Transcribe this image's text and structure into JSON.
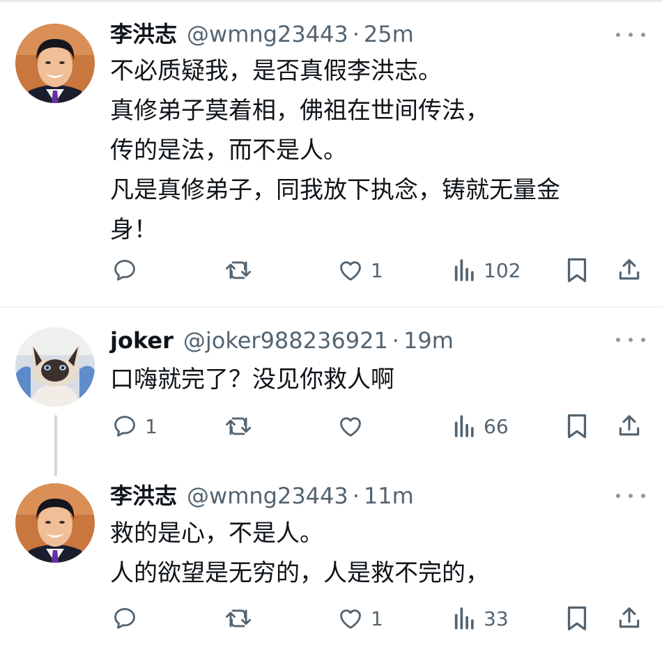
{
  "tweets": [
    {
      "name": "李洪志",
      "handle": "@wmng23443",
      "separator": "·",
      "time": "25m",
      "lines": [
        "不必质疑我，是否真假李洪志。",
        "真修弟子莫着相，佛祖在世间传法，",
        "传的是法，而不是人。",
        "凡是真修弟子，同我放下执念，铸就无量金",
        "身！"
      ],
      "replies": "",
      "retweets": "",
      "likes": "1",
      "views": "102"
    },
    {
      "name": "joker",
      "handle": "@joker988236921",
      "separator": "·",
      "time": "19m",
      "lines": [
        "口嗨就完了？没见你救人啊"
      ],
      "replies": "1",
      "retweets": "",
      "likes": "",
      "views": "66"
    },
    {
      "name": "李洪志",
      "handle": "@wmng23443",
      "separator": "·",
      "time": "11m",
      "lines": [
        "救的是心，不是人。",
        "人的欲望是无穷的，人是救不完的，"
      ],
      "replies": "",
      "retweets": "",
      "likes": "1",
      "views": "33"
    }
  ],
  "icons": {
    "reply": "reply-icon",
    "retweet": "retweet-icon",
    "like": "heart-icon",
    "views": "views-chart-icon",
    "bookmark": "bookmark-icon",
    "share": "share-icon",
    "more": "more-dots-icon"
  },
  "colors": {
    "text": "#0f1419",
    "secondary": "#536471",
    "icon": "#536471",
    "divider": "#eff3f4",
    "thread_line": "#cfd9de"
  }
}
